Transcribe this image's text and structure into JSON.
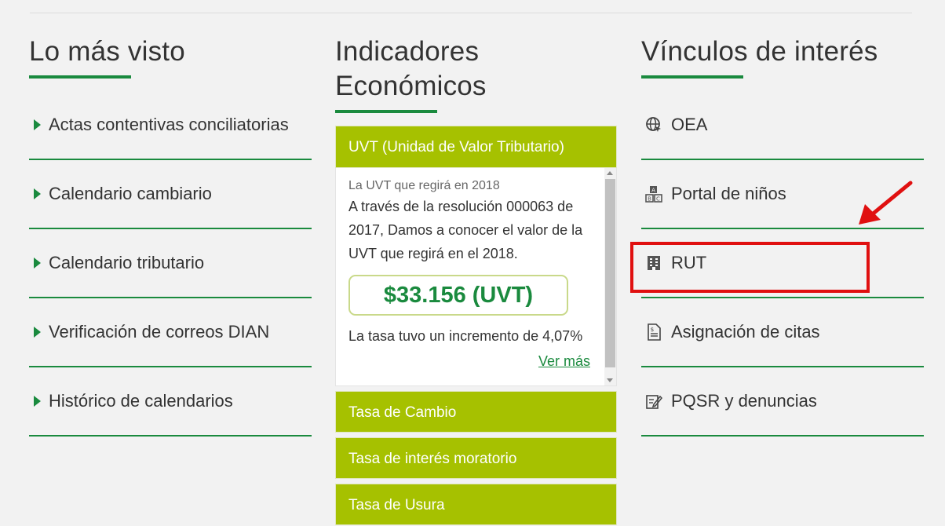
{
  "most_viewed": {
    "title": "Lo más visto",
    "items": [
      {
        "label": "Actas contentivas conciliatorias"
      },
      {
        "label": "Calendario cambiario"
      },
      {
        "label": "Calendario tributario"
      },
      {
        "label": "Verificación de correos DIAN"
      },
      {
        "label": "Histórico de calendarios"
      }
    ]
  },
  "indicators": {
    "title": "Indicadores Económicos",
    "uvt": {
      "header": "UVT (Unidad de Valor Tributario)",
      "subtitle": "La UVT que regirá en 2018",
      "text": "A través de la resolución 000063 de 2017, Damos a conocer el valor de la UVT que regirá en el 2018.",
      "value": "$33.156 (UVT)",
      "rate": "La tasa tuvo un incremento de 4,07%",
      "more": "Ver más"
    },
    "others": [
      {
        "label": "Tasa de Cambio"
      },
      {
        "label": "Tasa de interés moratorio"
      },
      {
        "label": "Tasa de Usura"
      }
    ]
  },
  "links": {
    "title": "Vínculos de interés",
    "items": [
      {
        "label": "OEA",
        "icon": "globe-cursor-icon"
      },
      {
        "label": "Portal de niños",
        "icon": "abc-blocks-icon"
      },
      {
        "label": "RUT",
        "icon": "document-building-icon"
      },
      {
        "label": "Asignación de citas",
        "icon": "dollar-document-icon"
      },
      {
        "label": "PQSR y denuncias",
        "icon": "edit-document-icon"
      }
    ]
  },
  "colors": {
    "accent_green": "#1a8a3e",
    "olive": "#a6c100",
    "annotation_red": "#e01010"
  }
}
